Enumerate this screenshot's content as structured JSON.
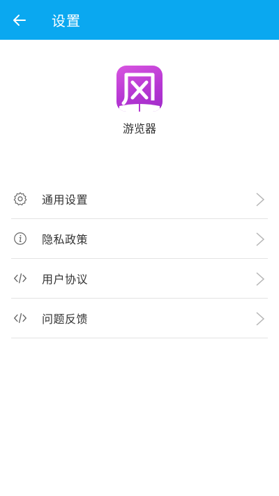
{
  "header": {
    "title": "设置",
    "back_icon": "back-arrow-icon",
    "background_color": "#0aa8f0"
  },
  "app": {
    "logo_char": "风",
    "name": "游览器",
    "logo_colors": [
      "#d855e0",
      "#9f2bc9"
    ]
  },
  "menu": {
    "items": [
      {
        "label": "通用设置",
        "icon": "gear-icon"
      },
      {
        "label": "隐私政策",
        "icon": "info-icon"
      },
      {
        "label": "用户协议",
        "icon": "code-icon"
      },
      {
        "label": "问题反馈",
        "icon": "code-icon"
      }
    ],
    "chevron_icon": "chevron-right-icon"
  }
}
